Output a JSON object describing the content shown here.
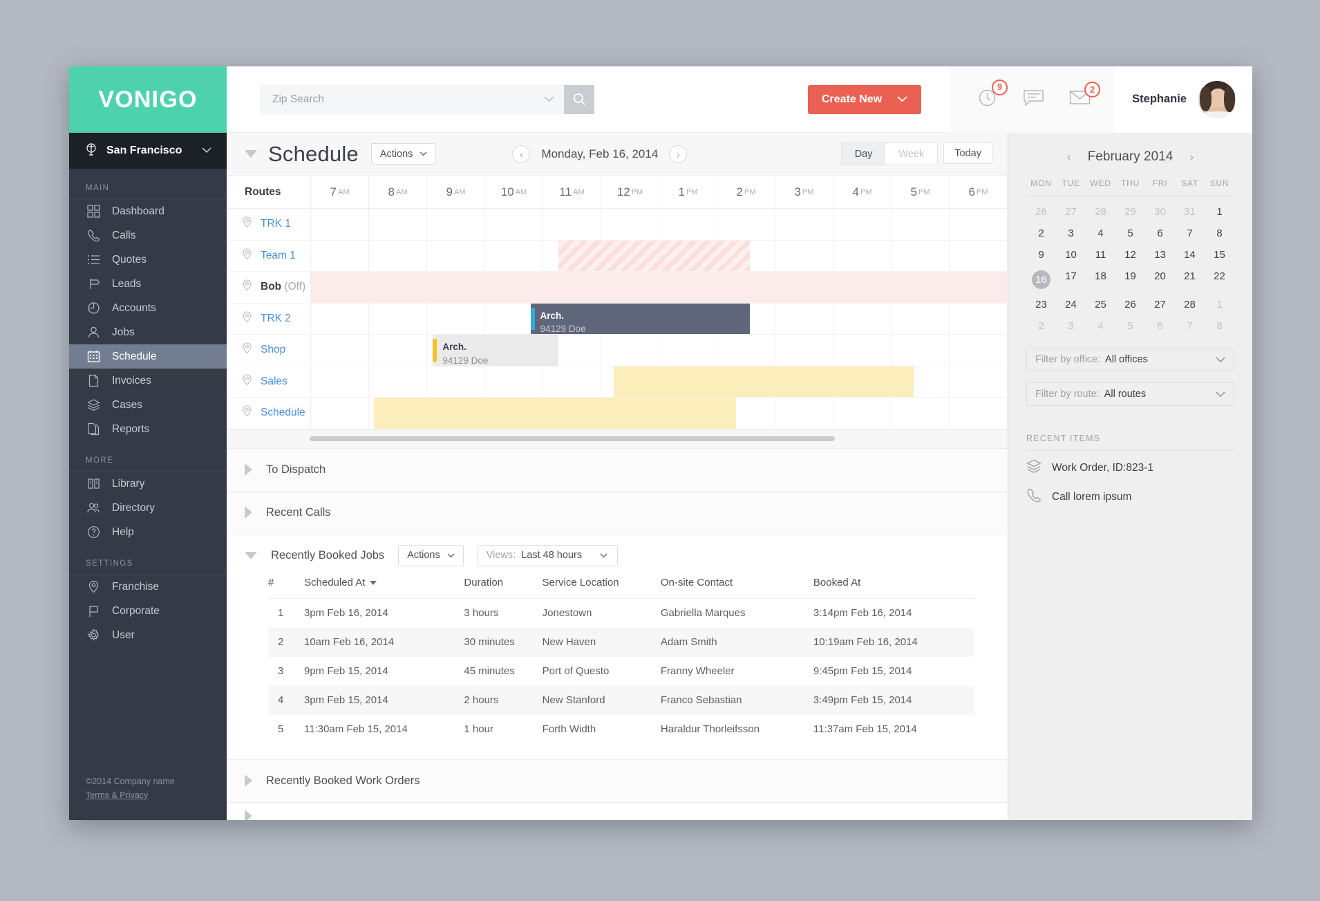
{
  "brand": {
    "logo": "VONIGO",
    "logo_color": "#4ed2ae"
  },
  "sidebar": {
    "office": "San Francisco",
    "sections": [
      {
        "label": "MAIN",
        "items": [
          {
            "label": "Dashboard",
            "icon": "dashboard-icon"
          },
          {
            "label": "Calls",
            "icon": "phone-icon"
          },
          {
            "label": "Quotes",
            "icon": "list-icon"
          },
          {
            "label": "Leads",
            "icon": "signpost-icon"
          },
          {
            "label": "Accounts",
            "icon": "pie-icon"
          },
          {
            "label": "Jobs",
            "icon": "person-icon"
          },
          {
            "label": "Schedule",
            "icon": "calendar-icon",
            "active": true
          },
          {
            "label": "Invoices",
            "icon": "document-icon"
          },
          {
            "label": "Cases",
            "icon": "layers-icon"
          },
          {
            "label": "Reports",
            "icon": "documents-icon"
          }
        ]
      },
      {
        "label": "MORE",
        "items": [
          {
            "label": "Library",
            "icon": "book-icon"
          },
          {
            "label": "Directory",
            "icon": "people-icon"
          },
          {
            "label": "Help",
            "icon": "question-icon"
          }
        ]
      },
      {
        "label": "SETTINGS",
        "items": [
          {
            "label": "Franchise",
            "icon": "pin-icon"
          },
          {
            "label": "Corporate",
            "icon": "flag-icon"
          },
          {
            "label": "User",
            "icon": "gear-icon"
          }
        ]
      }
    ],
    "footer": {
      "copyright": "©2014 Company name",
      "terms": "Terms & Privacy"
    }
  },
  "topbar": {
    "search_placeholder": "Zip Search",
    "search_value": "",
    "create_button": "Create New",
    "notifications": [
      {
        "icon": "clock-icon",
        "count": "9"
      },
      {
        "icon": "chat-icon",
        "count": ""
      },
      {
        "icon": "envelope-icon",
        "count": "2"
      }
    ],
    "user_name": "Stephanie"
  },
  "schedule": {
    "title": "Schedule",
    "actions_label": "Actions",
    "date": "Monday, Feb 16, 2014",
    "views": {
      "day": "Day",
      "week": "Week",
      "today": "Today",
      "active": "Day"
    },
    "routes_header": "Routes",
    "hours": [
      {
        "h": "7",
        "m": "AM"
      },
      {
        "h": "8",
        "m": "AM"
      },
      {
        "h": "9",
        "m": "AM"
      },
      {
        "h": "10",
        "m": "AM"
      },
      {
        "h": "11",
        "m": "AM"
      },
      {
        "h": "12",
        "m": "PM"
      },
      {
        "h": "1",
        "m": "PM"
      },
      {
        "h": "2",
        "m": "PM"
      },
      {
        "h": "3",
        "m": "PM"
      },
      {
        "h": "4",
        "m": "PM"
      },
      {
        "h": "5",
        "m": "PM"
      },
      {
        "h": "6",
        "m": "PM"
      }
    ],
    "rows": [
      {
        "label": "TRK 1",
        "suffix": ""
      },
      {
        "label": "Team 1",
        "suffix": ""
      },
      {
        "label": "Bob",
        "suffix": "(Off)",
        "off": true
      },
      {
        "label": "TRK 2",
        "suffix": ""
      },
      {
        "label": "Shop",
        "suffix": ""
      },
      {
        "label": "Sales",
        "suffix": ""
      },
      {
        "label": "Schedule",
        "suffix": ""
      }
    ],
    "events": [
      {
        "row": 1,
        "kind": "hatch",
        "start_pct": 35.5,
        "width_pct": 27.5,
        "title": "",
        "subtitle": ""
      },
      {
        "row": 2,
        "kind": "pinkband",
        "start_pct": 0,
        "width_pct": 100,
        "title": "",
        "subtitle": ""
      },
      {
        "row": 3,
        "kind": "dark",
        "start_pct": 31.5,
        "width_pct": 31.5,
        "title": "Arch.",
        "subtitle": "94129 Doe",
        "bar_color": "#35aadf"
      },
      {
        "row": 4,
        "kind": "grey",
        "start_pct": 17.5,
        "width_pct": 18.0,
        "title": "Arch.",
        "subtitle": "94129 Doe",
        "bar_color": "#f2c520"
      },
      {
        "row": 5,
        "kind": "yellow",
        "start_pct": 43.5,
        "width_pct": 43.0,
        "title": "",
        "subtitle": ""
      },
      {
        "row": 6,
        "kind": "yellow",
        "start_pct": 9.0,
        "width_pct": 52.0,
        "title": "",
        "subtitle": ""
      }
    ]
  },
  "panels": {
    "to_dispatch": "To Dispatch",
    "recent_calls": "Recent Calls",
    "recent_work_orders": "Recently Booked Work Orders"
  },
  "booked_jobs": {
    "title": "Recently Booked Jobs",
    "actions_label": "Actions",
    "views_label": "Views:",
    "views_value": "Last 48 hours",
    "columns": [
      "#",
      "Scheduled At",
      "Duration",
      "Service Location",
      "On-site Contact",
      "Booked At"
    ],
    "sort_column": "Scheduled At",
    "rows": [
      [
        "1",
        "3pm Feb 16, 2014",
        "3 hours",
        "Jonestown",
        "Gabriella Marques",
        "3:14pm Feb 16, 2014"
      ],
      [
        "2",
        "10am Feb 16, 2014",
        "30 minutes",
        "New Haven",
        "Adam Smith",
        "10:19am Feb 16, 2014"
      ],
      [
        "3",
        "9pm Feb 15, 2014",
        "45 minutes",
        "Port of Questo",
        "Franny Wheeler",
        "9:45pm Feb 15, 2014"
      ],
      [
        "4",
        "3pm Feb 15, 2014",
        "2 hours",
        "New Stanford",
        "Franco Sebastian",
        "3:49pm Feb 15, 2014"
      ],
      [
        "5",
        "11:30am Feb 15, 2014",
        "1 hour",
        "Forth Width",
        "Haraldur Thorleifsson",
        "11:37am Feb 15, 2014"
      ]
    ]
  },
  "rightcol": {
    "calendar": {
      "month": "February 2014",
      "dow": [
        "MON",
        "TUE",
        "WED",
        "THU",
        "FRI",
        "SAT",
        "SUN"
      ],
      "weeks": [
        [
          {
            "d": "26",
            "mut": true
          },
          {
            "d": "27",
            "mut": true
          },
          {
            "d": "28",
            "mut": true
          },
          {
            "d": "29",
            "mut": true
          },
          {
            "d": "30",
            "mut": true
          },
          {
            "d": "31",
            "mut": true
          },
          {
            "d": "1"
          }
        ],
        [
          {
            "d": "2"
          },
          {
            "d": "3"
          },
          {
            "d": "4"
          },
          {
            "d": "5"
          },
          {
            "d": "6"
          },
          {
            "d": "7"
          },
          {
            "d": "8"
          }
        ],
        [
          {
            "d": "9"
          },
          {
            "d": "10"
          },
          {
            "d": "11"
          },
          {
            "d": "12"
          },
          {
            "d": "13"
          },
          {
            "d": "14"
          },
          {
            "d": "15"
          }
        ],
        [
          {
            "d": "16",
            "sel": true
          },
          {
            "d": "17"
          },
          {
            "d": "18"
          },
          {
            "d": "19"
          },
          {
            "d": "20"
          },
          {
            "d": "21"
          },
          {
            "d": "22"
          }
        ],
        [
          {
            "d": "23"
          },
          {
            "d": "24"
          },
          {
            "d": "25"
          },
          {
            "d": "26"
          },
          {
            "d": "27"
          },
          {
            "d": "28"
          },
          {
            "d": "1",
            "mut": true
          }
        ],
        [
          {
            "d": "2",
            "mut": true
          },
          {
            "d": "3",
            "mut": true
          },
          {
            "d": "4",
            "mut": true
          },
          {
            "d": "5",
            "mut": true
          },
          {
            "d": "6",
            "mut": true
          },
          {
            "d": "7",
            "mut": true
          },
          {
            "d": "8",
            "mut": true
          }
        ]
      ]
    },
    "filters": [
      {
        "label": "Filter by office:",
        "value": "All offices"
      },
      {
        "label": "Filter by route:",
        "value": "All routes"
      }
    ],
    "recent_items_header": "RECENT ITEMS",
    "recent_items": [
      {
        "icon": "layers-icon",
        "label": "Work Order, ID:823-1"
      },
      {
        "icon": "phone-icon",
        "label": "Call lorem ipsum"
      }
    ]
  }
}
